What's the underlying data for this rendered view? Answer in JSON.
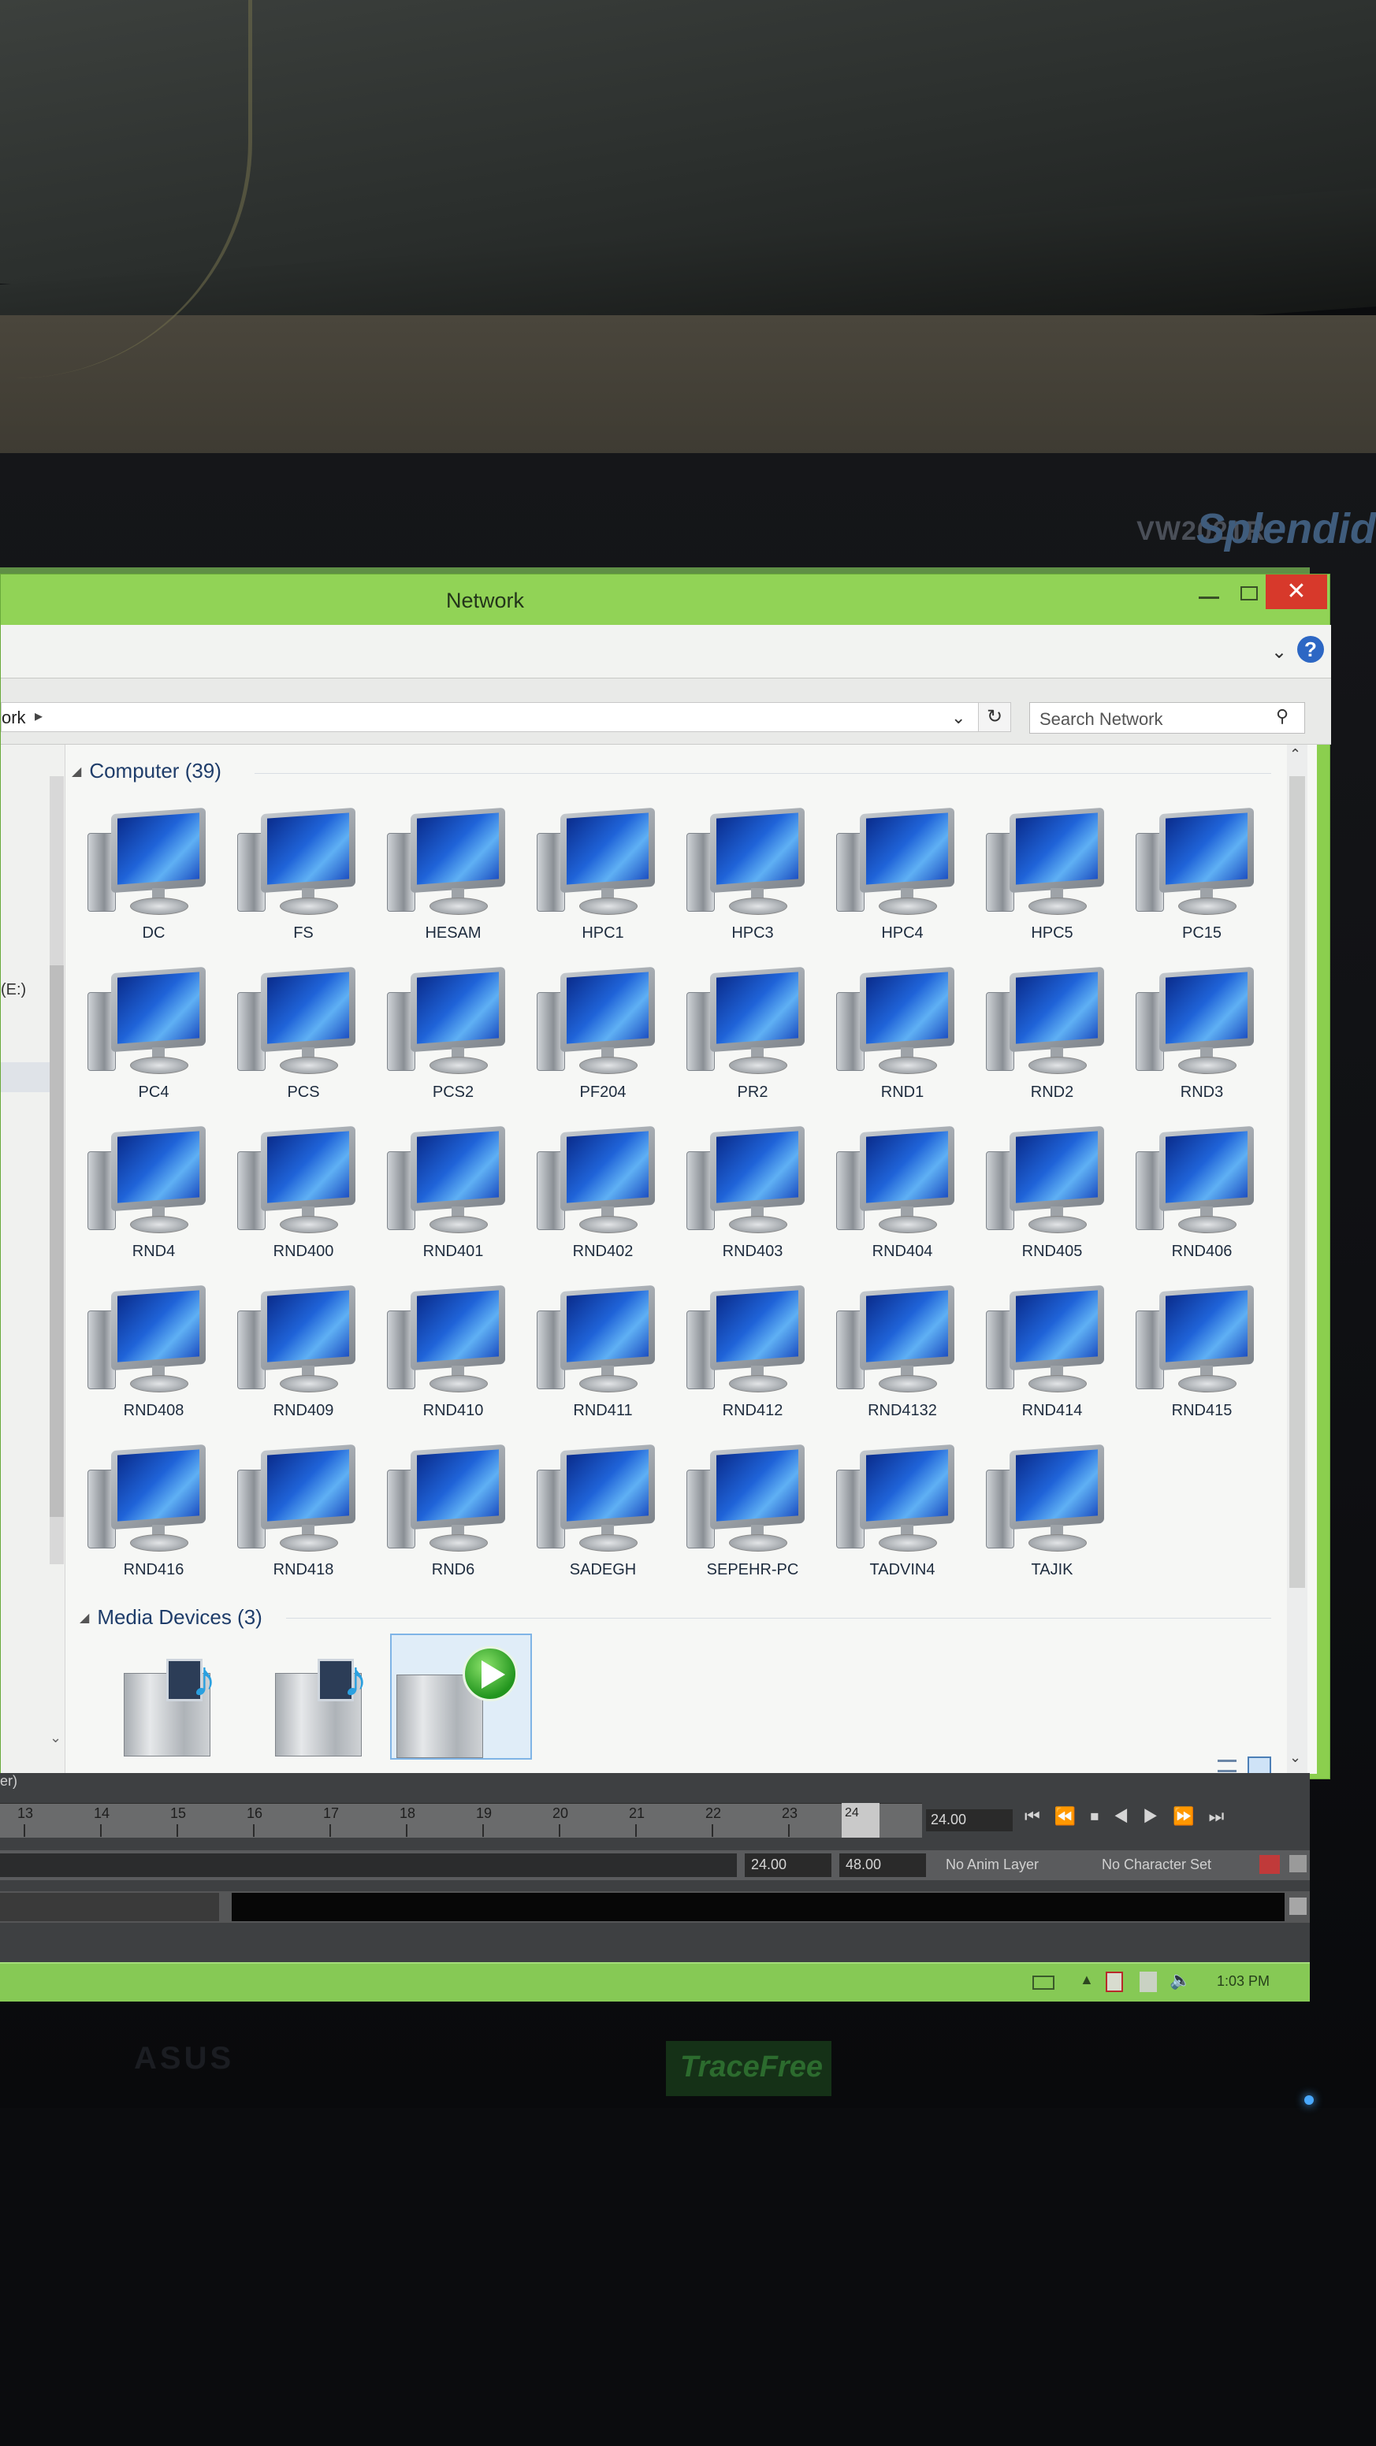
{
  "monitor": {
    "model": "VW202TR",
    "splendid": "Splendid",
    "brand": "ASUS",
    "trace_label": "TraceFree"
  },
  "window": {
    "title": "Network",
    "close_symbol": "✕",
    "help_symbol": "?",
    "ribbon_chevron": "⌄"
  },
  "address_bar": {
    "path_text": "ork",
    "separator": "▸",
    "dropdown_symbol": "⌄",
    "refresh_symbol": "↻"
  },
  "search": {
    "placeholder": "Search Network",
    "icon": "⚲"
  },
  "nav_pane": {
    "drive_label": "(E:)"
  },
  "groups": {
    "computer": {
      "header": "Computer (39)",
      "triangle": "◢"
    },
    "media": {
      "header": "Media Devices (3)",
      "triangle": "◢"
    }
  },
  "computers": [
    "DC",
    "FS",
    "HESAM",
    "HPC1",
    "HPC3",
    "HPC4",
    "HPC5",
    "PC15",
    "PC4",
    "PCS",
    "PCS2",
    "PF204",
    "PR2",
    "RND1",
    "RND2",
    "RND3",
    "RND4",
    "RND400",
    "RND401",
    "RND402",
    "RND403",
    "RND404",
    "RND405",
    "RND406",
    "RND408",
    "RND409",
    "RND410",
    "RND411",
    "RND412",
    "RND4132",
    "RND414",
    "RND415",
    "RND416",
    "RND418",
    "RND6",
    "SADEGH",
    "SEPEHR-PC",
    "TADVIN4",
    "TAJIK"
  ],
  "media_devices": [
    {
      "type": "media-player-icon"
    },
    {
      "type": "media-player-icon"
    },
    {
      "type": "play-icon",
      "selected": true
    }
  ],
  "maya": {
    "header_text": "er)",
    "ruler_ticks": [
      "13",
      "14",
      "15",
      "16",
      "17",
      "18",
      "19",
      "20",
      "21",
      "22",
      "23",
      "24"
    ],
    "current_frame_label": "24",
    "current_frame": "24.00",
    "playback_symbols": "⏮ ⏪ ⏹ ◀ ▶ ⏩ ⏭",
    "range_start": "24.00",
    "range_end": "48.00",
    "anim_layer": "No Anim Layer",
    "character_set": "No Character Set"
  },
  "taskbar": {
    "clock": "1:03 PM",
    "tray_up": "▲",
    "volume_symbol": "🔈"
  }
}
